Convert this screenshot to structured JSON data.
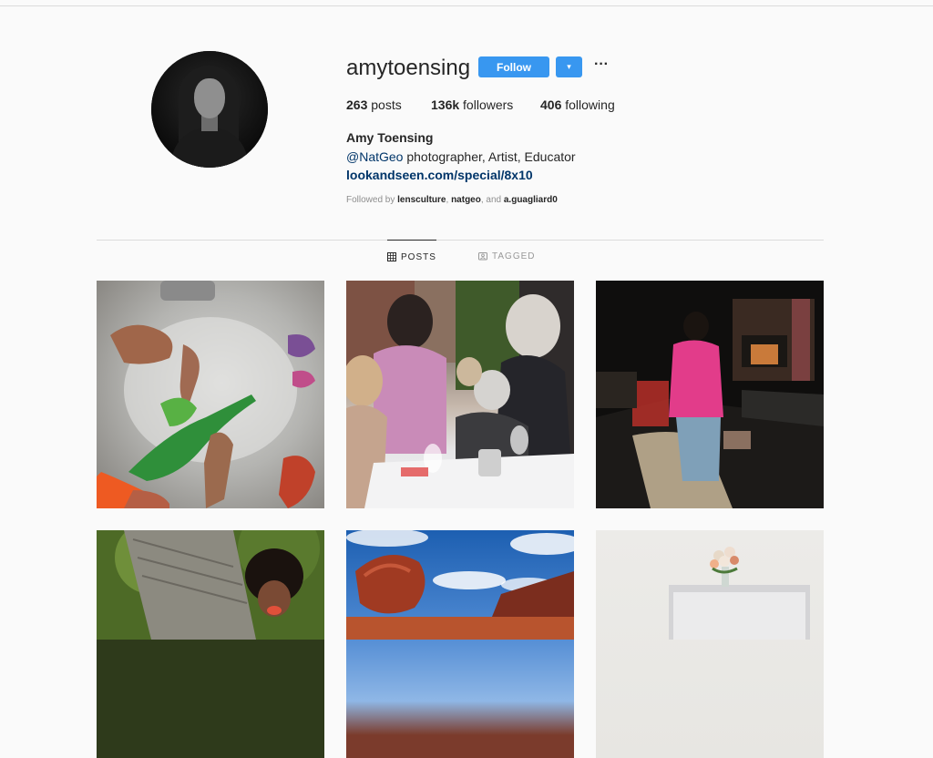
{
  "profile": {
    "username": "amytoensing",
    "follow_label": "Follow",
    "dropdown_glyph": "▾",
    "more_glyph": "···",
    "stats": {
      "posts_count": "263",
      "posts_label": "posts",
      "followers_count": "136k",
      "followers_label": "followers",
      "following_count": "406",
      "following_label": "following"
    },
    "full_name": "Amy Toensing",
    "bio_mention": "@NatGeo",
    "bio_text": " photographer, Artist, Educator",
    "link": "lookandseen.com/special/8x10",
    "followed_by_prefix": "Followed by ",
    "followed_by_users": [
      "lensculture",
      "natgeo",
      "a.guagliard0"
    ],
    "followed_by_sep1": ", ",
    "followed_by_sep2": ", and "
  },
  "tabs": [
    {
      "label": "POSTS",
      "icon": "grid-icon",
      "active": true
    },
    {
      "label": "TAGGED",
      "icon": "tag-icon",
      "active": false
    }
  ],
  "posts": [
    {
      "id": "post-1",
      "subject": "toys-in-bathtub"
    },
    {
      "id": "post-2",
      "subject": "outdoor-dinner"
    },
    {
      "id": "post-3",
      "subject": "child-in-dark-room"
    },
    {
      "id": "post-4",
      "subject": "child-in-forest"
    },
    {
      "id": "post-5",
      "subject": "red-rock-sky"
    },
    {
      "id": "post-6",
      "subject": "flowers-white-room"
    }
  ],
  "colors": {
    "accent": "#3897f0",
    "link": "#003569",
    "text": "#262626",
    "muted": "#8e8e8e",
    "background": "#fafafa",
    "border": "#dbdbdb"
  }
}
